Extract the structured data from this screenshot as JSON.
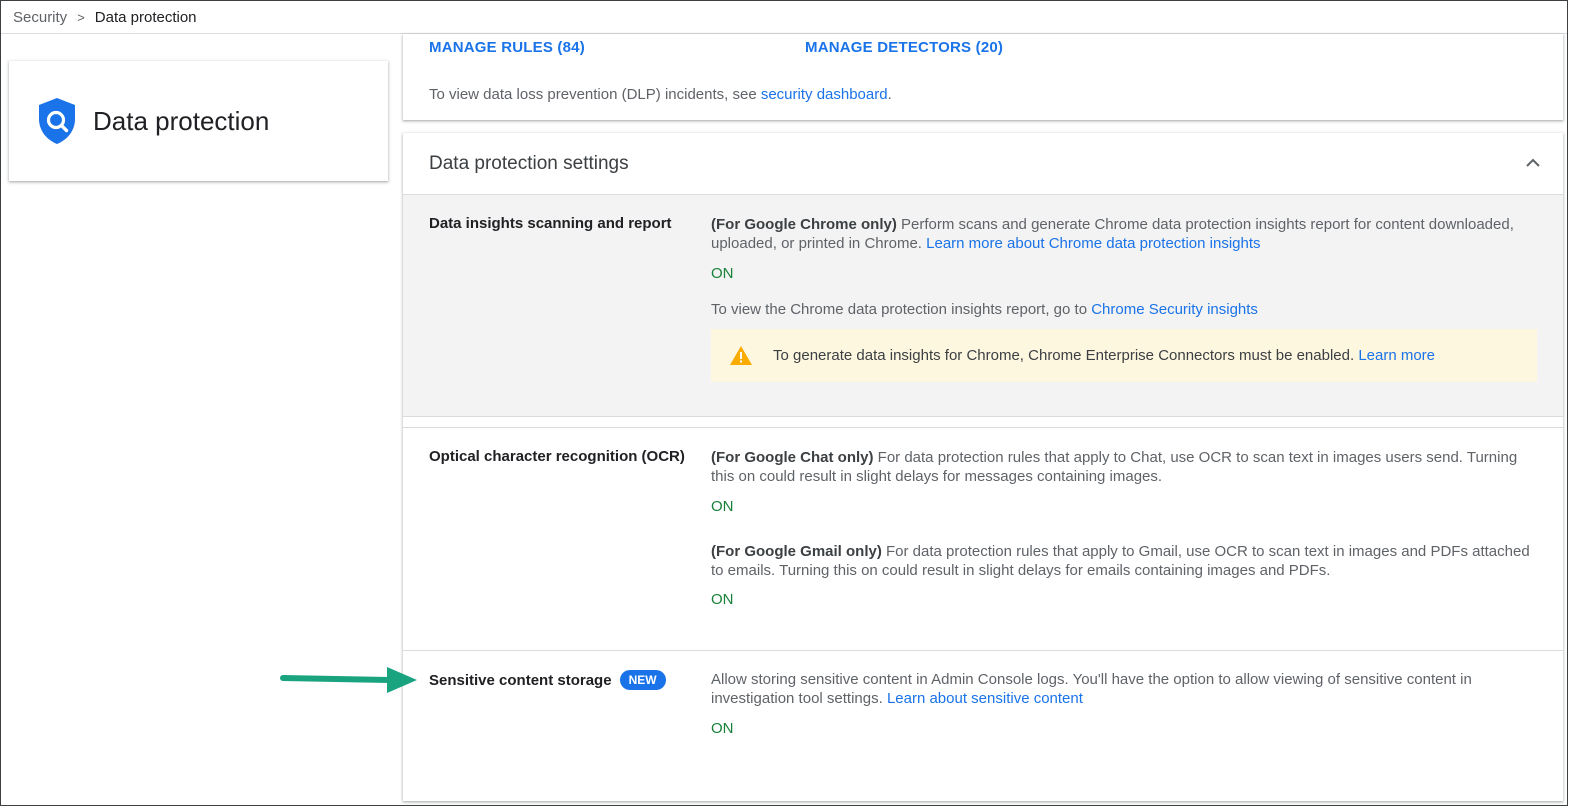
{
  "breadcrumb": {
    "parent": "Security",
    "separator": ">",
    "current": "Data protection"
  },
  "left_card": {
    "title": "Data protection",
    "icon": "shield-search-icon"
  },
  "top_panel": {
    "manage_rules": "MANAGE RULES (84)",
    "manage_detectors": "MANAGE DETECTORS (20)",
    "dlp_text": "To view data loss prevention (DLP) incidents, see ",
    "dlp_link": "security dashboard",
    "dlp_end": "."
  },
  "settings": {
    "title": "Data protection settings",
    "collapse_icon": "chevron-up-icon",
    "insights": {
      "label": "Data insights scanning and report",
      "prefix": "(For Google Chrome only)",
      "text": " Perform scans and generate Chrome data protection insights report for content downloaded, uploaded, or printed in Chrome. ",
      "link": "Learn more about Chrome data protection insights",
      "status": "ON",
      "report_text": "To view the Chrome data protection insights report, go to ",
      "report_link": "Chrome Security insights",
      "warning_icon": "warning-icon",
      "warning_text": "To generate data insights for Chrome, Chrome Enterprise Connectors must be enabled. ",
      "warning_link": "Learn more"
    },
    "ocr": {
      "label": "Optical character recognition (OCR)",
      "chat_prefix": "(For Google Chat only)",
      "chat_text": " For data protection rules that apply to Chat, use OCR to scan text in images users send. Turning this on could result in slight delays for messages containing images.",
      "chat_status": "ON",
      "gmail_prefix": "(For Google Gmail only)",
      "gmail_text": " For data protection rules that apply to Gmail, use OCR to scan text in images and PDFs attached to emails. Turning this on could result in slight delays for emails containing images and PDFs.",
      "gmail_status": "ON"
    },
    "storage": {
      "label": "Sensitive content storage",
      "badge": "NEW",
      "text": "Allow storing sensitive content in Admin Console logs. You'll have the option to allow viewing of sensitive content in investigation tool settings. ",
      "link": "Learn about sensitive content",
      "status": "ON"
    }
  },
  "annotation": {
    "arrow_color": "#1aa37f"
  },
  "colors": {
    "link": "#1a73e8",
    "on": "#188038",
    "warning_bg": "#fef7e0",
    "warning_icon": "#f9ab00"
  }
}
